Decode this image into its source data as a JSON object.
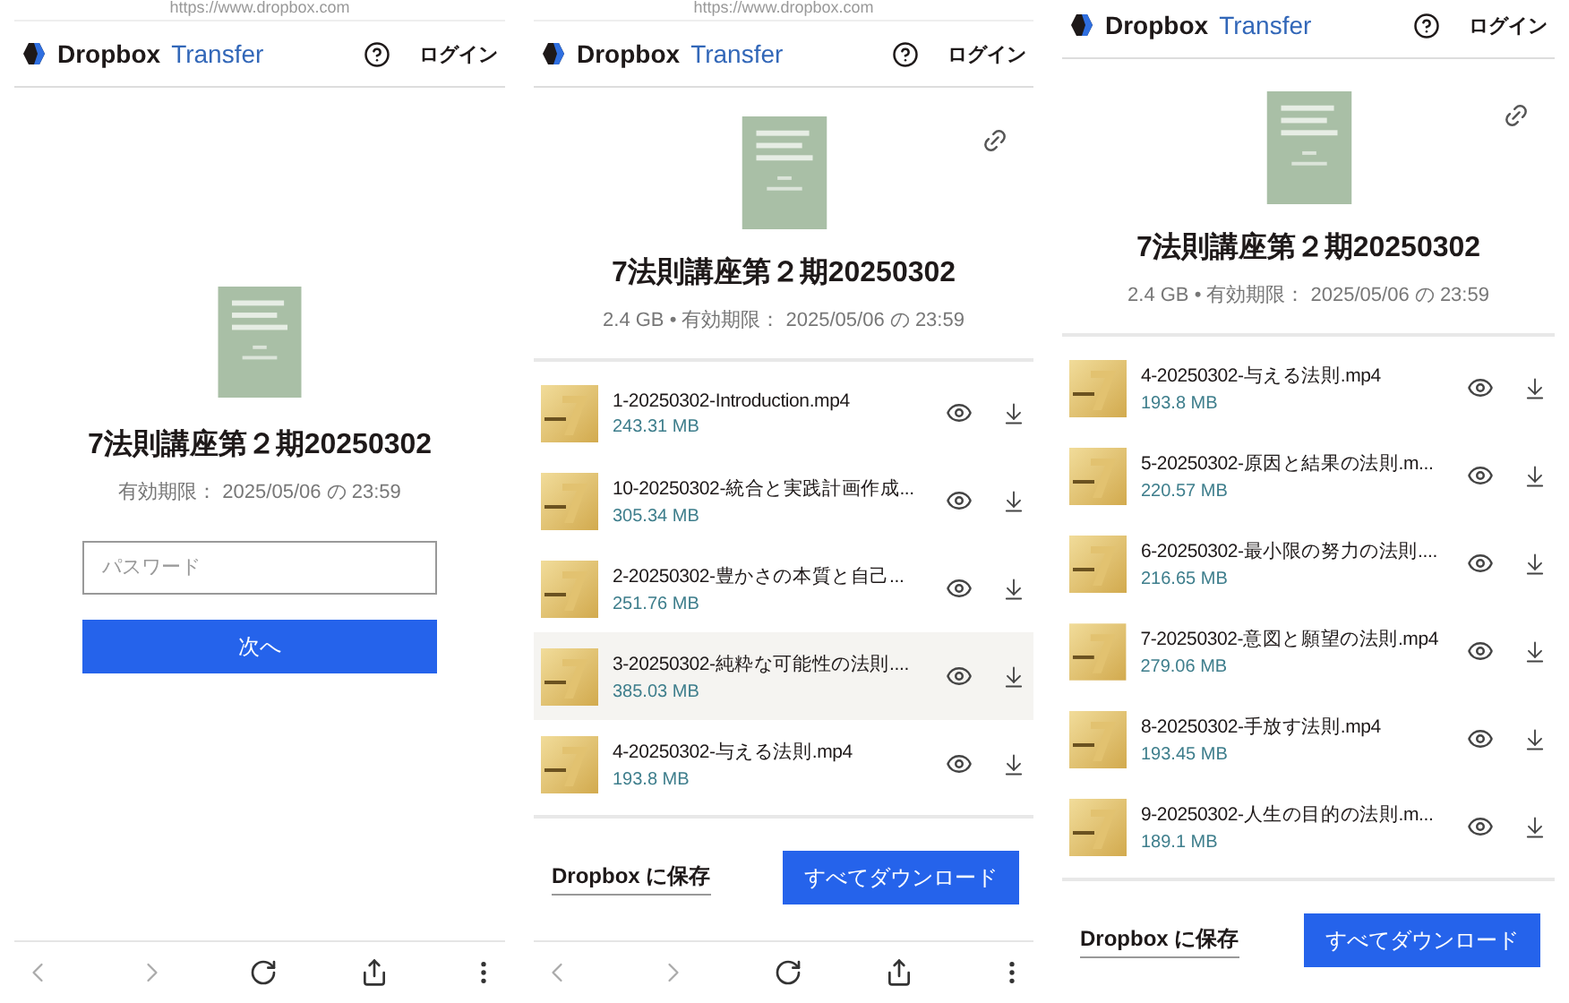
{
  "screens": [
    {
      "kind": "password",
      "url": "https://www.dropbox.com",
      "header": {
        "brand": "Dropbox",
        "product": "Transfer",
        "login": "ログイン"
      },
      "title": "7法則講座第２期20250302",
      "meta": "有効期限： 2025/05/06 の 23:59",
      "password_field": {
        "placeholder": "パスワード"
      },
      "next_button": "次へ",
      "browser_bar": true
    },
    {
      "kind": "files",
      "url": "https://www.dropbox.com",
      "header": {
        "brand": "Dropbox",
        "product": "Transfer",
        "login": "ログイン"
      },
      "title": "7法則講座第２期20250302",
      "meta": "2.4 GB • 有効期限： 2025/05/06 の 23:59",
      "files": [
        {
          "name": "1-20250302-Introduction.mp4",
          "size": "243.31 MB",
          "highlighted": false
        },
        {
          "name": "10-20250302-統合と実践計画作成...",
          "size": "305.34 MB",
          "highlighted": false
        },
        {
          "name": "2-20250302-豊かさの本質と自己...",
          "size": "251.76 MB",
          "highlighted": false
        },
        {
          "name": "3-20250302-純粋な可能性の法則....",
          "size": "385.03 MB",
          "highlighted": true
        },
        {
          "name": "4-20250302-与える法則.mp4",
          "size": "193.8 MB",
          "highlighted": false
        }
      ],
      "save_link": "Dropbox に保存",
      "download_all": "すべてダウンロード",
      "browser_bar": true
    },
    {
      "kind": "files",
      "header": {
        "brand": "Dropbox",
        "product": "Transfer",
        "login": "ログイン"
      },
      "title": "7法則講座第２期20250302",
      "meta": "2.4 GB • 有効期限： 2025/05/06 の 23:59",
      "files": [
        {
          "name": "4-20250302-与える法則.mp4",
          "size": "193.8 MB",
          "highlighted": false
        },
        {
          "name": "5-20250302-原因と結果の法則.m...",
          "size": "220.57 MB",
          "highlighted": false
        },
        {
          "name": "6-20250302-最小限の努力の法則....",
          "size": "216.65 MB",
          "highlighted": false
        },
        {
          "name": "7-20250302-意図と願望の法則.mp4",
          "size": "279.06 MB",
          "highlighted": false
        },
        {
          "name": "8-20250302-手放す法則.mp4",
          "size": "193.45 MB",
          "highlighted": false
        },
        {
          "name": "9-20250302-人生の目的の法則.m...",
          "size": "189.1 MB",
          "highlighted": false
        }
      ],
      "save_link": "Dropbox に保存",
      "download_all": "すべてダウンロード",
      "browser_bar": false
    }
  ]
}
